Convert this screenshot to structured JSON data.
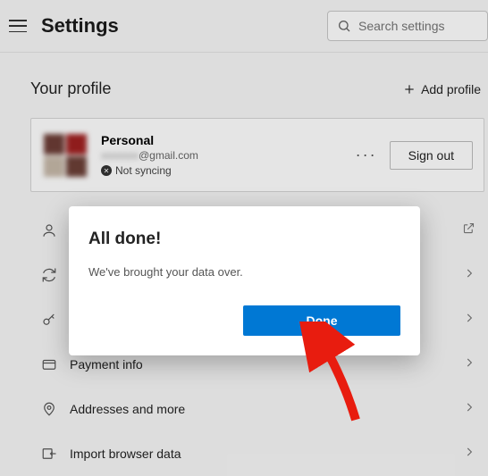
{
  "header": {
    "title": "Settings",
    "search_placeholder": "Search settings"
  },
  "profile": {
    "section_title": "Your profile",
    "add_label": "Add profile",
    "name": "Personal",
    "email_domain": "@gmail.com",
    "sync_status": "Not syncing",
    "signout_label": "Sign out"
  },
  "rows": [
    {
      "label": "",
      "icon": "person",
      "action": "external"
    },
    {
      "label": "",
      "icon": "sync",
      "action": "chevron"
    },
    {
      "label": "",
      "icon": "key",
      "action": "chevron"
    },
    {
      "label": "Payment info",
      "icon": "card",
      "action": "chevron"
    },
    {
      "label": "Addresses and more",
      "icon": "pin",
      "action": "chevron"
    },
    {
      "label": "Import browser data",
      "icon": "import",
      "action": "chevron"
    }
  ],
  "modal": {
    "title": "All done!",
    "body": "We've brought your data over.",
    "done_label": "Done"
  }
}
